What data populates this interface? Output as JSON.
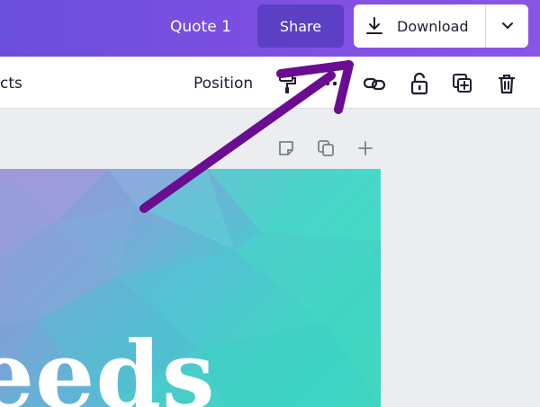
{
  "header": {
    "doc_title": "Quote 1",
    "share_label": "Share",
    "download_label": "Download"
  },
  "toolbar": {
    "cut_label": "cts",
    "position_label": "Position"
  },
  "canvas": {
    "text": "eeds"
  },
  "icons": {
    "download": "download-icon",
    "dropdown": "chevron-down-icon",
    "paint_roller": "paint-roller-icon",
    "link": "link-icon",
    "lock": "unlock-icon",
    "duplicate": "duplicate-page-icon",
    "delete": "trash-icon",
    "note": "note-icon",
    "copy": "copy-icon",
    "add": "plus-icon",
    "annotation_arrow": "annotation-arrow-icon"
  },
  "colors": {
    "accent_purple": "#7b4fe0",
    "share_bg": "#5b3fc4",
    "annotation": "#6a0d91"
  }
}
